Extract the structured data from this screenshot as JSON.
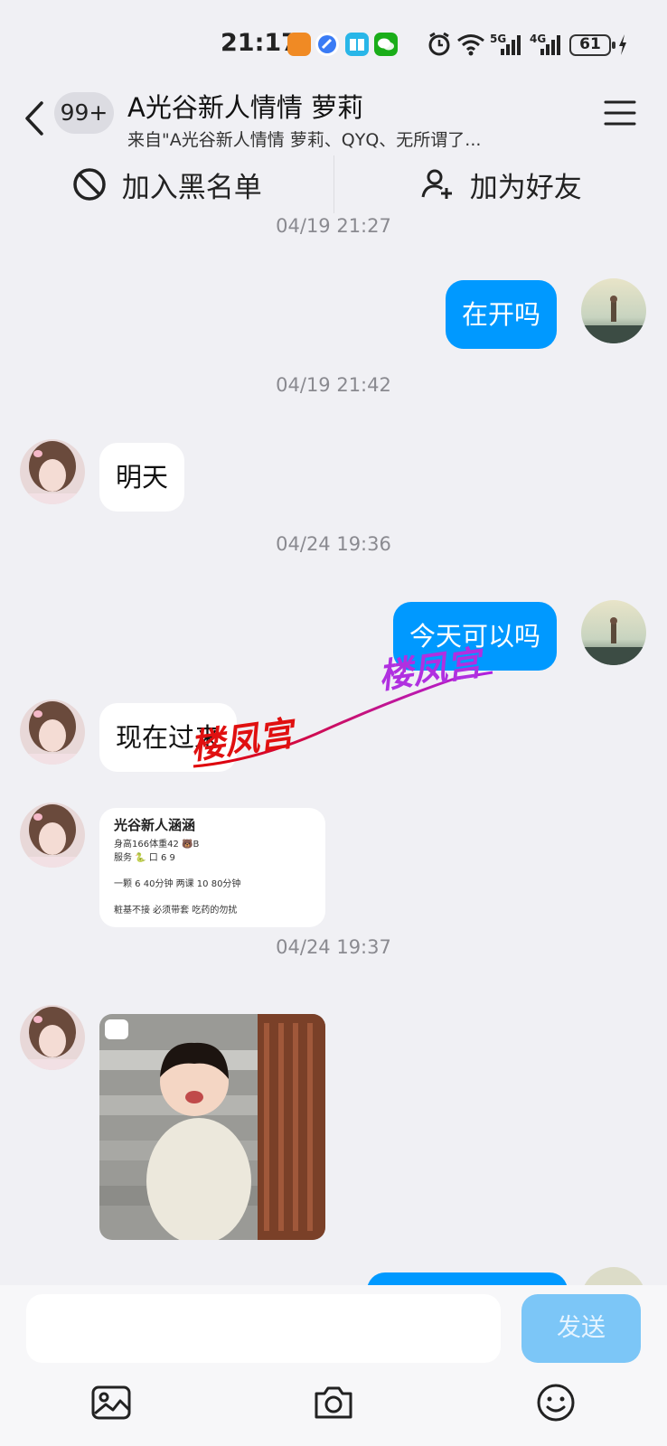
{
  "status_bar": {
    "time": "21:17",
    "network_labels": [
      "5G",
      "4G"
    ],
    "battery": "61"
  },
  "header": {
    "back_icon": "chevron-left-icon",
    "unread_badge": "99+",
    "title": "A光谷新人情情 萝莉",
    "subtitle": "来自\"A光谷新人情情 萝莉、QYQ、无所谓了...",
    "menu_icon": "hamburger-menu-icon"
  },
  "actions": {
    "block_label": "加入黑名单",
    "add_friend_label": "加为好友"
  },
  "chat": {
    "timestamps": [
      "04/19 21:27",
      "04/19 21:42",
      "04/24 19:36",
      "04/24 19:37"
    ],
    "messages": [
      {
        "sender": "me",
        "text": "在开吗"
      },
      {
        "sender": "other",
        "text": "明天"
      },
      {
        "sender": "me",
        "text": "今天可以吗"
      },
      {
        "sender": "other",
        "text": "现在过来"
      }
    ],
    "card": {
      "title": "光谷新人涵涵",
      "lines": [
        "身高166体重42 🐻B",
        "服务 🐍 口 6 9",
        "一颗 6 40分钟 两课 10 80分钟",
        "粧基不接 必须带套 吃药的勿扰"
      ]
    },
    "watermark": "楼凤宫"
  },
  "input_bar": {
    "placeholder": "",
    "send_label": "发送",
    "tools": [
      "image-icon",
      "camera-icon",
      "emoji-icon"
    ]
  },
  "colors": {
    "accent": "#0099ff",
    "background": "#f0f0f4",
    "send_disabled": "#7cc6f7"
  }
}
